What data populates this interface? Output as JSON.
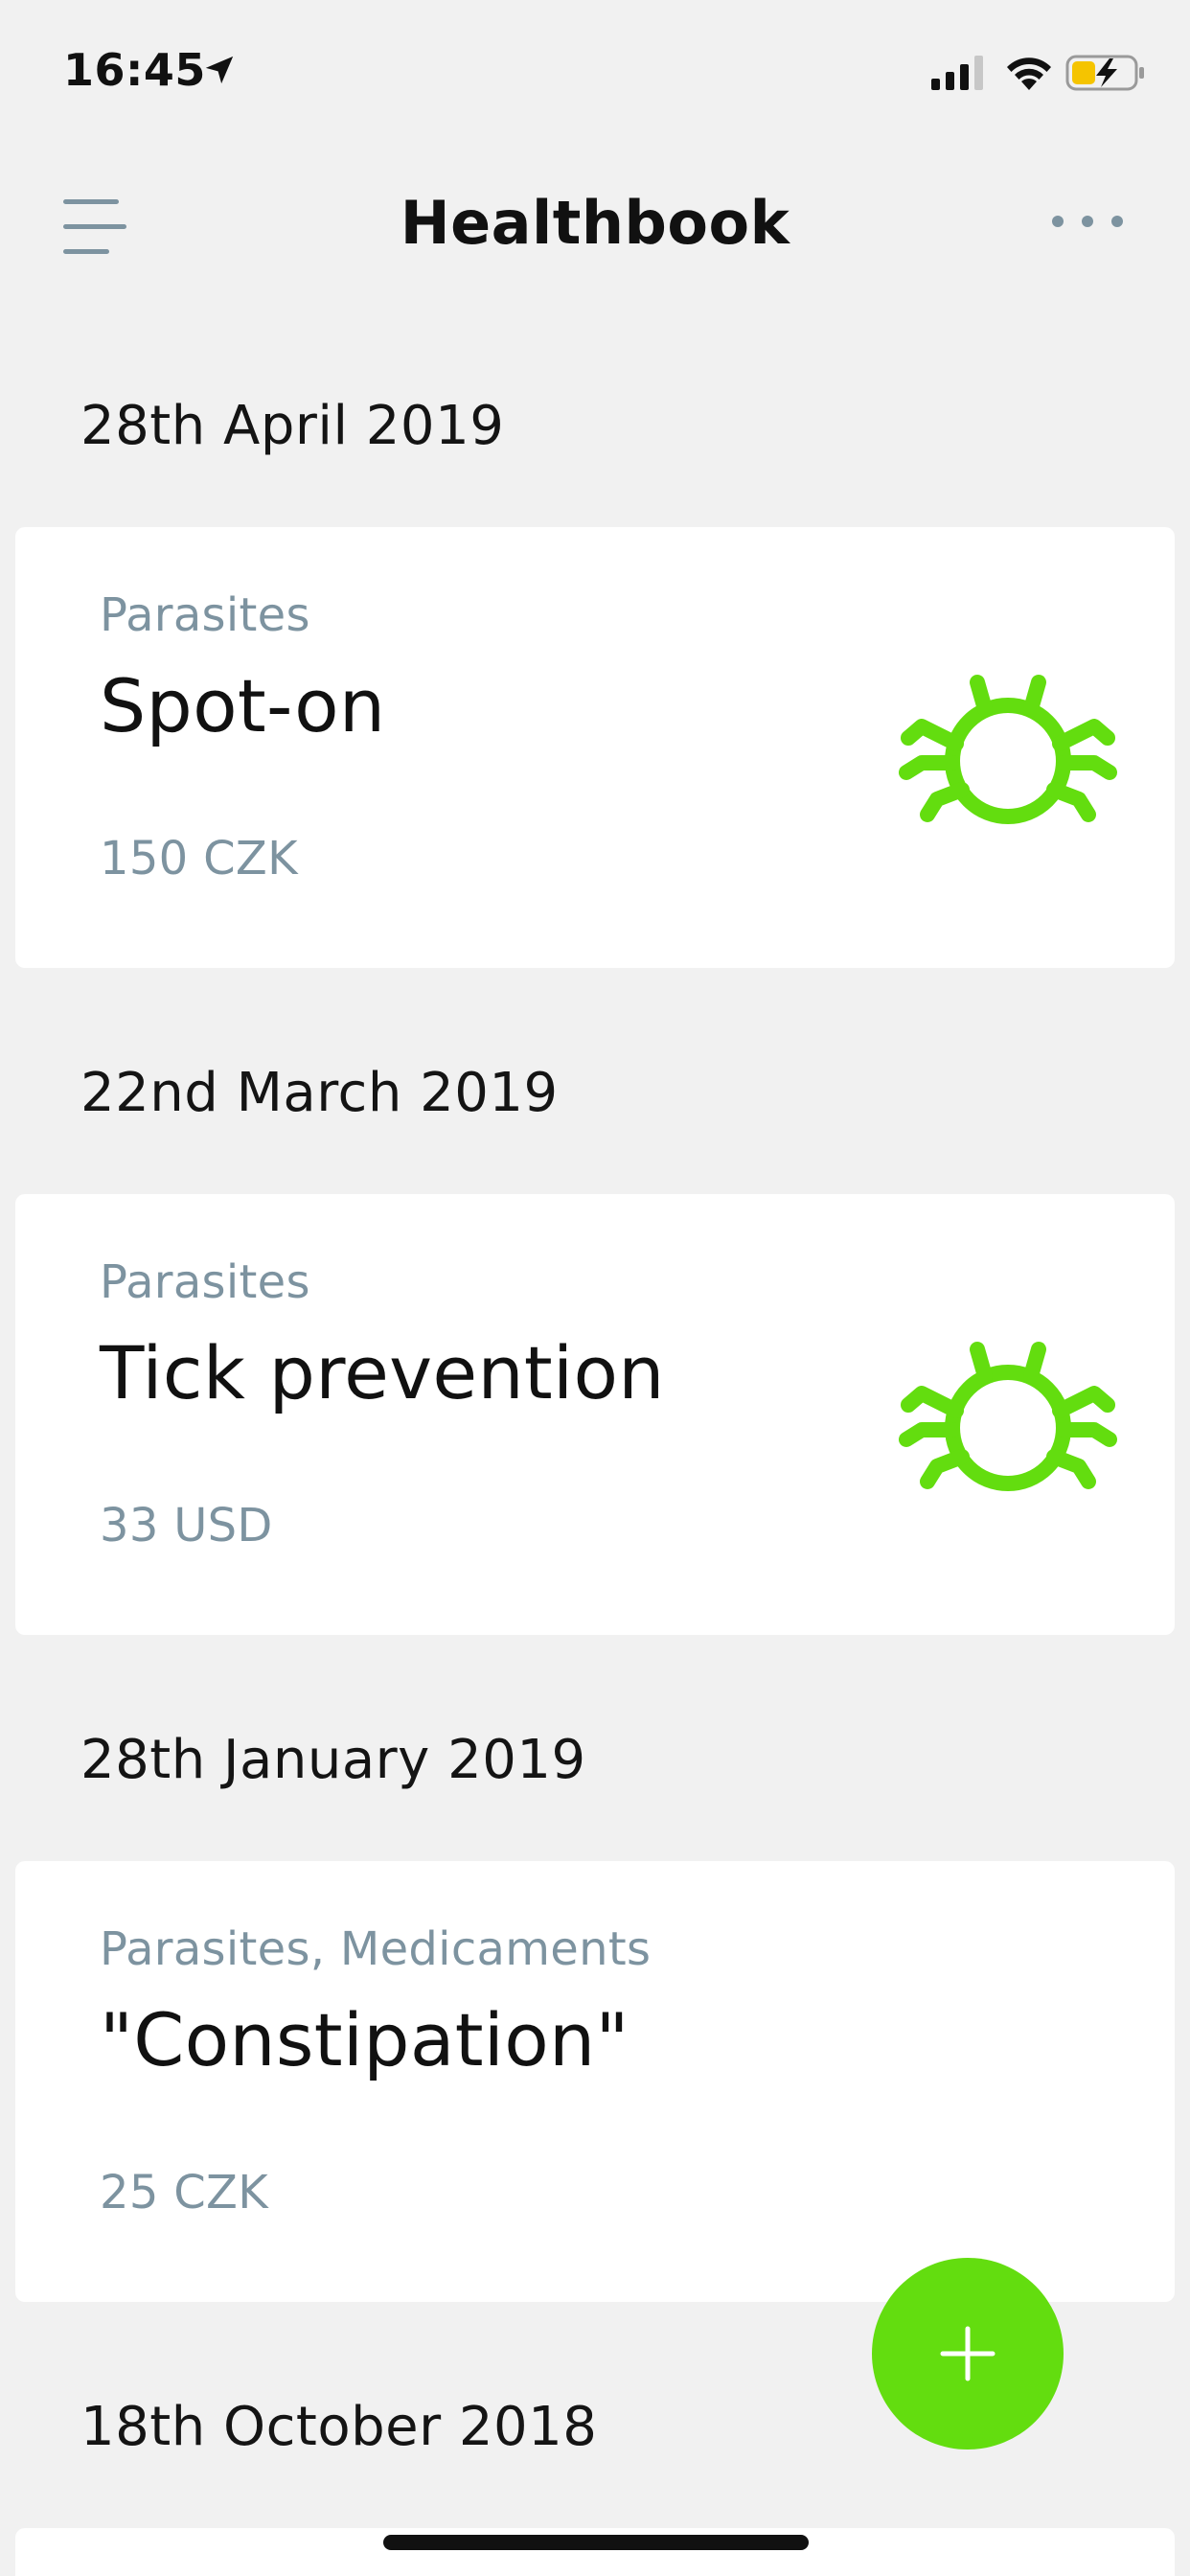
{
  "status_bar": {
    "time": "16:45"
  },
  "nav": {
    "title": "Healthbook"
  },
  "entries": [
    {
      "date": "28th April 2019",
      "category": "Parasites",
      "title": "Spot-on",
      "price": "150 CZK",
      "icon": "bug-icon"
    },
    {
      "date": "22nd March 2019",
      "category": "Parasites",
      "title": "Tick prevention",
      "price": "33 USD",
      "icon": "bug-icon"
    },
    {
      "date": "28th January 2019",
      "category": "Parasites, Medicaments",
      "title": "\"Constipation\"",
      "price": "25 CZK",
      "icon": ""
    },
    {
      "date": "18th October 2018"
    }
  ],
  "colors": {
    "accent": "#63dd0f",
    "muted_text": "#7d93a0",
    "background": "#f1f1f1",
    "battery_fill": "#f5c400"
  }
}
